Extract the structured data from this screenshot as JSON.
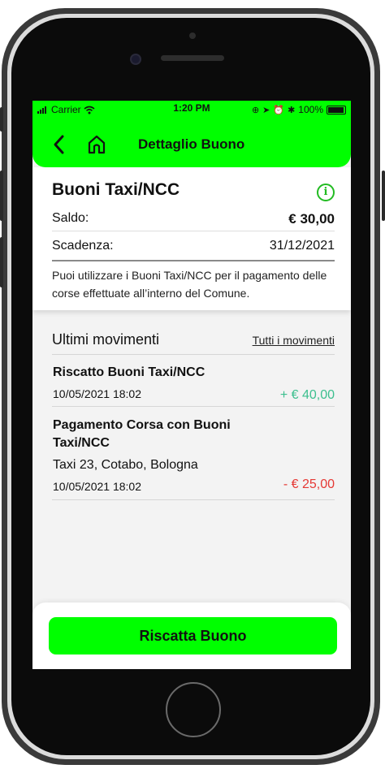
{
  "status_bar": {
    "carrier": "Carrier",
    "time": "1:20 PM",
    "battery": "100%"
  },
  "header": {
    "title": "Dettaglio Buono",
    "back_icon": "chevron-left-icon",
    "home_icon": "home-icon"
  },
  "voucher": {
    "title": "Buoni Taxi/NCC",
    "info_icon": "info-icon",
    "balance_label": "Saldo:",
    "balance_value": "€ 30,00",
    "expiry_label": "Scadenza:",
    "expiry_value": "31/12/2021",
    "description": "Puoi utilizzare i Buoni Taxi/NCC per il pagamento delle corse effettuate all’interno del Comune."
  },
  "movements": {
    "header": "Ultimi movimenti",
    "all_link": "Tutti i movimenti",
    "items": [
      {
        "title": "Riscatto Buoni Taxi/NCC",
        "date": "10/05/2021 18:02",
        "amount": "+ € 40,00"
      },
      {
        "title": "Pagamento Corsa con Buoni Taxi/NCC",
        "subtitle": "Taxi 23,  Cotabo, Bologna",
        "date": "10/05/2021 18:02",
        "amount": "- € 25,00"
      }
    ]
  },
  "cta": {
    "label": "Riscatta Buono"
  },
  "colors": {
    "accent": "#00ff00",
    "positive": "#3cbf8e",
    "negative": "#e53935"
  }
}
